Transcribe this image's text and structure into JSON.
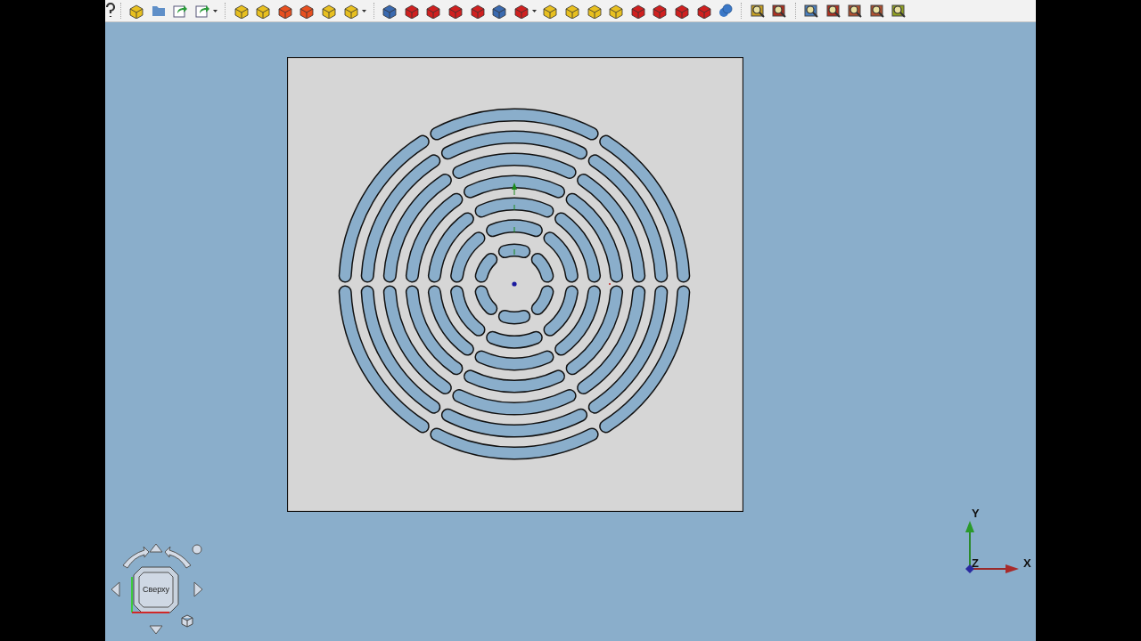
{
  "view": {
    "navigation_cube": {
      "face_label": "Сверху"
    },
    "axis_indicator": {
      "x_label": "X",
      "y_label": "Y",
      "z_label": "Z"
    }
  }
}
